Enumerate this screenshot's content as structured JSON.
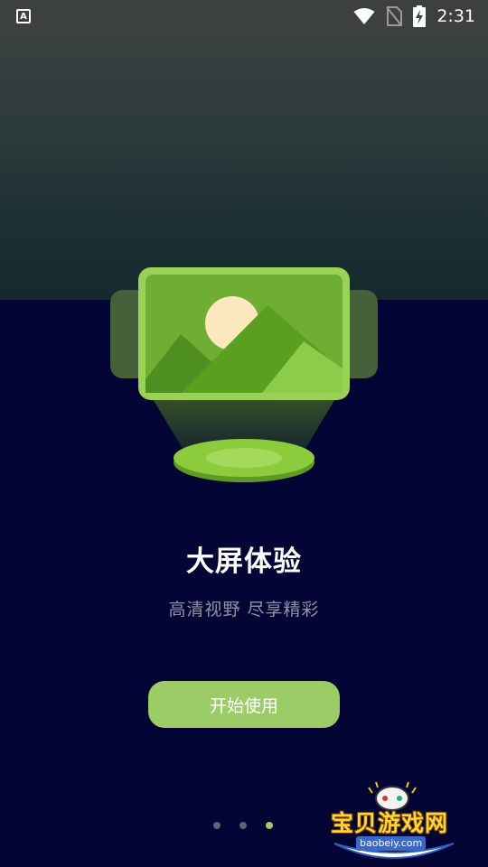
{
  "status_bar": {
    "notification_icon": "font-a-icon",
    "icons": [
      "wifi-icon",
      "no-sim-icon",
      "battery-charging-icon"
    ],
    "time": "2:31"
  },
  "onboarding": {
    "illustration": "big-screen-landscape-icon",
    "title": "大屏体验",
    "subtitle": "高清视野 尽享精彩",
    "start_button": "开始使用",
    "page_count": 3,
    "active_page": 3
  },
  "watermark": {
    "text": "宝贝游戏网",
    "url": "baobeiy.com"
  },
  "colors": {
    "background": "#030634",
    "accent_green": "#9ccc65",
    "status_bar": "#3c403e"
  }
}
